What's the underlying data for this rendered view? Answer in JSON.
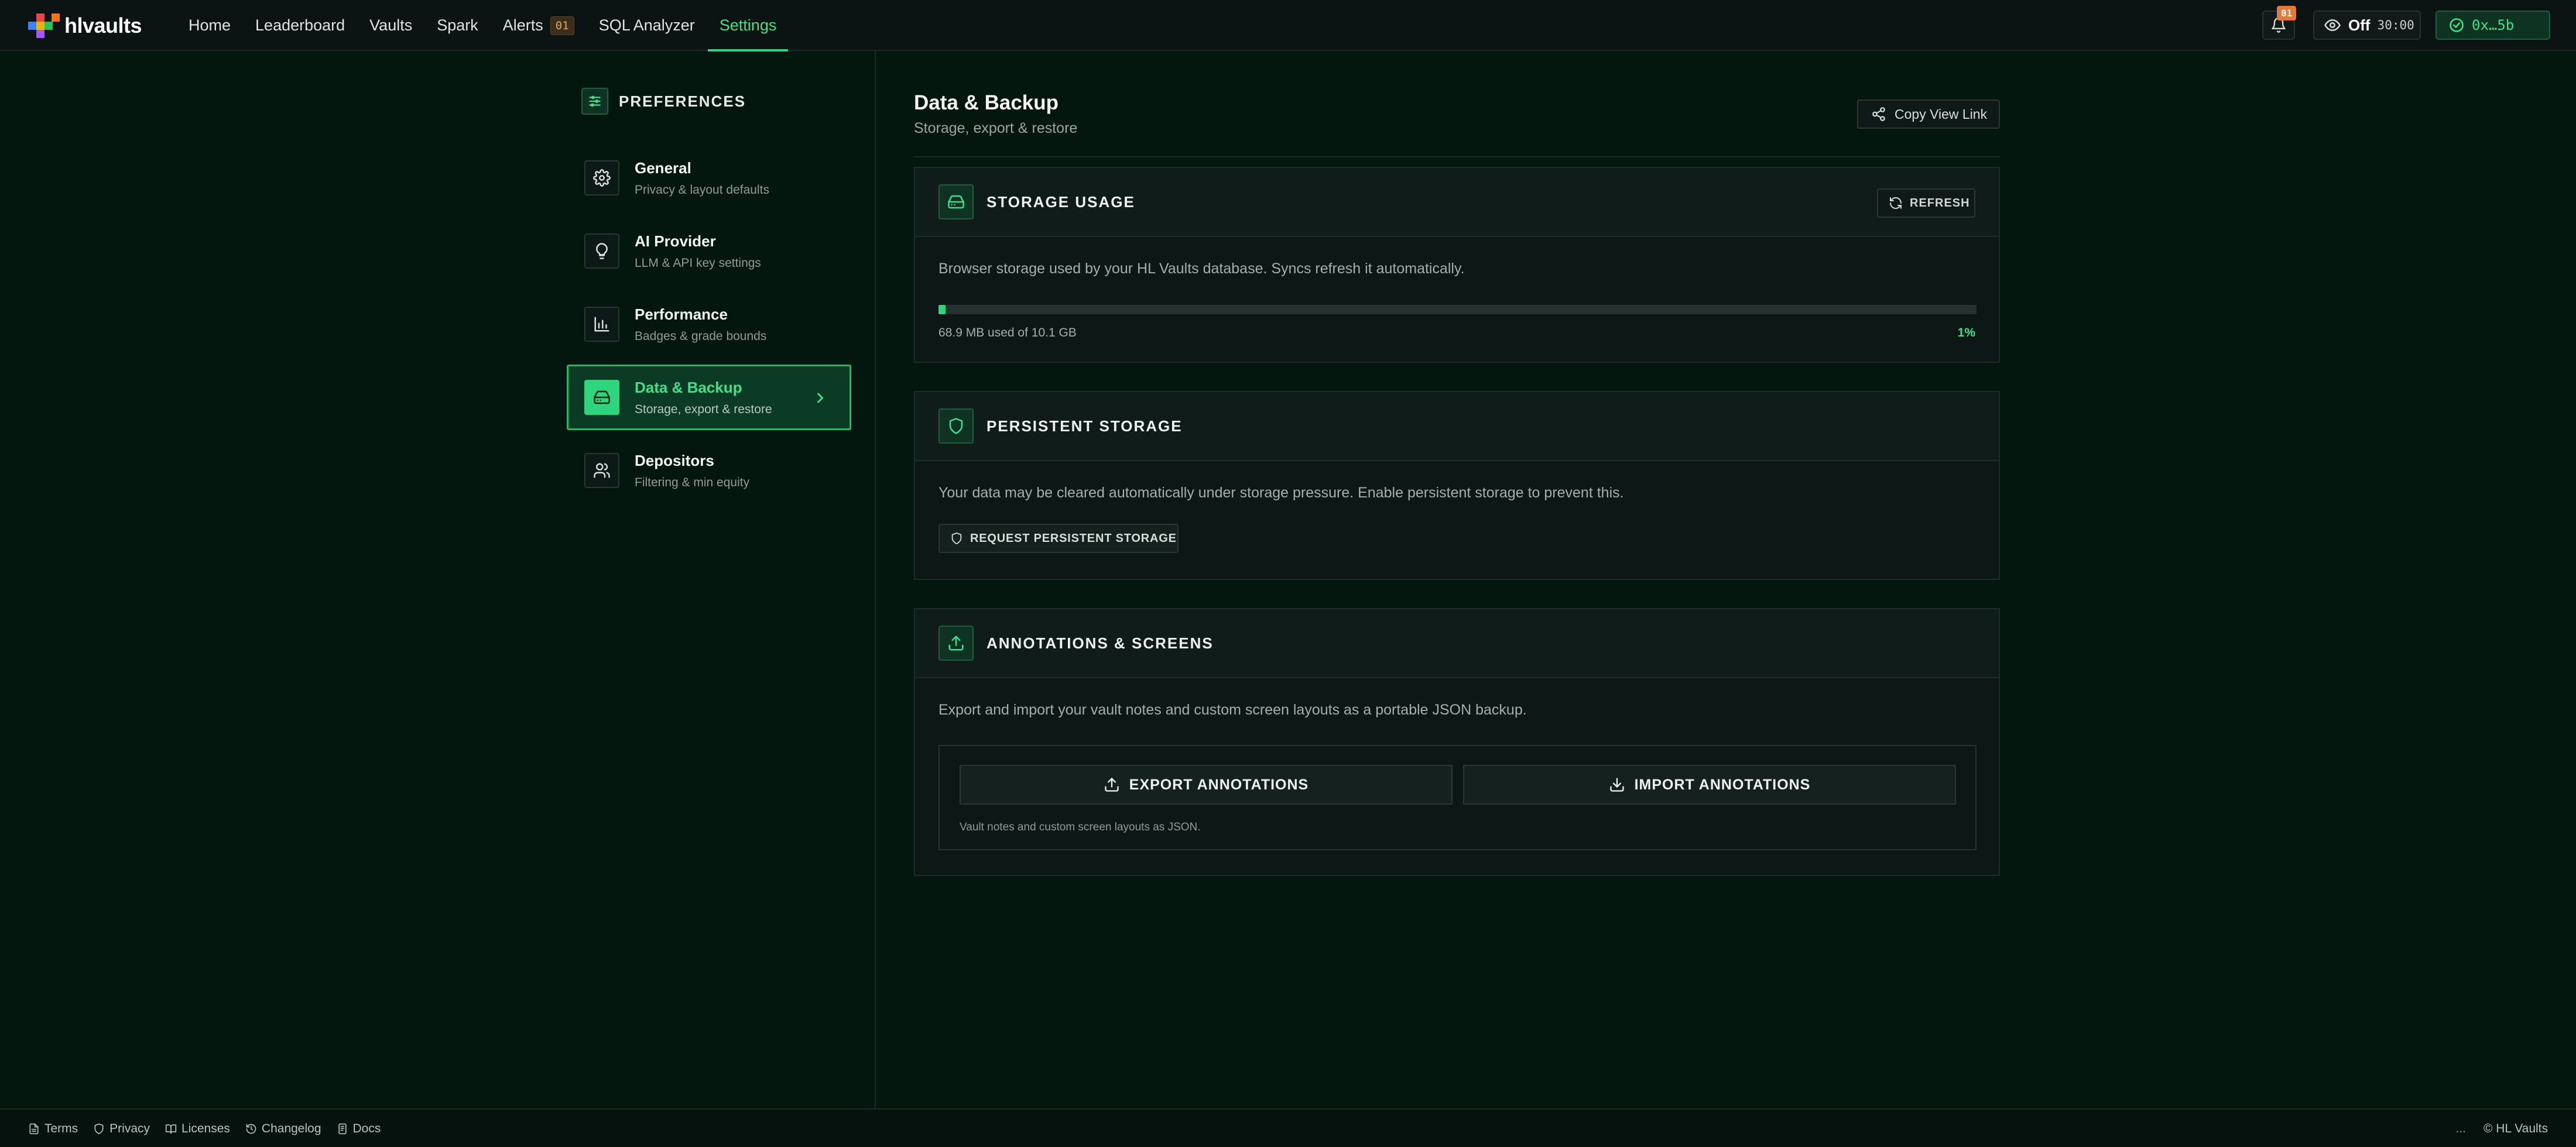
{
  "app": {
    "name": "hlvaults"
  },
  "nav": {
    "links": [
      {
        "label": "Home"
      },
      {
        "label": "Leaderboard"
      },
      {
        "label": "Vaults"
      },
      {
        "label": "Spark"
      },
      {
        "label": "Alerts",
        "badge": "01"
      },
      {
        "label": "SQL Analyzer"
      },
      {
        "label": "Settings",
        "active": true
      }
    ],
    "notifications_badge": "01",
    "view_mode": {
      "label": "Off",
      "timer": "30:00"
    },
    "wallet": {
      "address": "0x…5b"
    }
  },
  "sidebar": {
    "header": "PREFERENCES",
    "items": [
      {
        "title": "General",
        "subtitle": "Privacy & layout defaults",
        "icon": "gear-icon"
      },
      {
        "title": "AI Provider",
        "subtitle": "LLM & API key settings",
        "icon": "lightbulb-icon"
      },
      {
        "title": "Performance",
        "subtitle": "Badges & grade bounds",
        "icon": "bar-chart-icon"
      },
      {
        "title": "Data & Backup",
        "subtitle": "Storage, export & restore",
        "icon": "hard-drive-icon",
        "active": true
      },
      {
        "title": "Depositors",
        "subtitle": "Filtering & min equity",
        "icon": "users-icon"
      }
    ]
  },
  "main": {
    "title": "Data & Backup",
    "subtitle": "Storage, export & restore",
    "copy_link_label": "Copy View Link",
    "storage": {
      "title": "STORAGE USAGE",
      "refresh_label": "REFRESH",
      "description": "Browser storage used by your HL Vaults database. Syncs refresh it automatically.",
      "used_text": "68.9 MB used of 10.1 GB",
      "percent_text": "1%",
      "percent_value": 0.0067
    },
    "persistent": {
      "title": "PERSISTENT STORAGE",
      "description": "Your data may be cleared automatically under storage pressure. Enable persistent storage to prevent this.",
      "button_label": "REQUEST PERSISTENT STORAGE"
    },
    "annotations": {
      "title": "ANNOTATIONS & SCREENS",
      "description": "Export and import your vault notes and custom screen layouts as a portable JSON backup.",
      "export_label": "EXPORT ANNOTATIONS",
      "import_label": "IMPORT ANNOTATIONS",
      "note": "Vault notes and custom screen layouts as JSON."
    }
  },
  "footer": {
    "links": [
      {
        "label": "Terms",
        "icon": "document-icon"
      },
      {
        "label": "Privacy",
        "icon": "shield-icon"
      },
      {
        "label": "Licenses",
        "icon": "book-icon"
      },
      {
        "label": "Changelog",
        "icon": "history-icon"
      },
      {
        "label": "Docs",
        "icon": "docs-icon"
      }
    ],
    "ellipsis": "...",
    "copyright": "© HL Vaults"
  },
  "colors": {
    "accent": "#2fd57d",
    "background": "#04170f",
    "badge_orange": "#e3783a"
  }
}
